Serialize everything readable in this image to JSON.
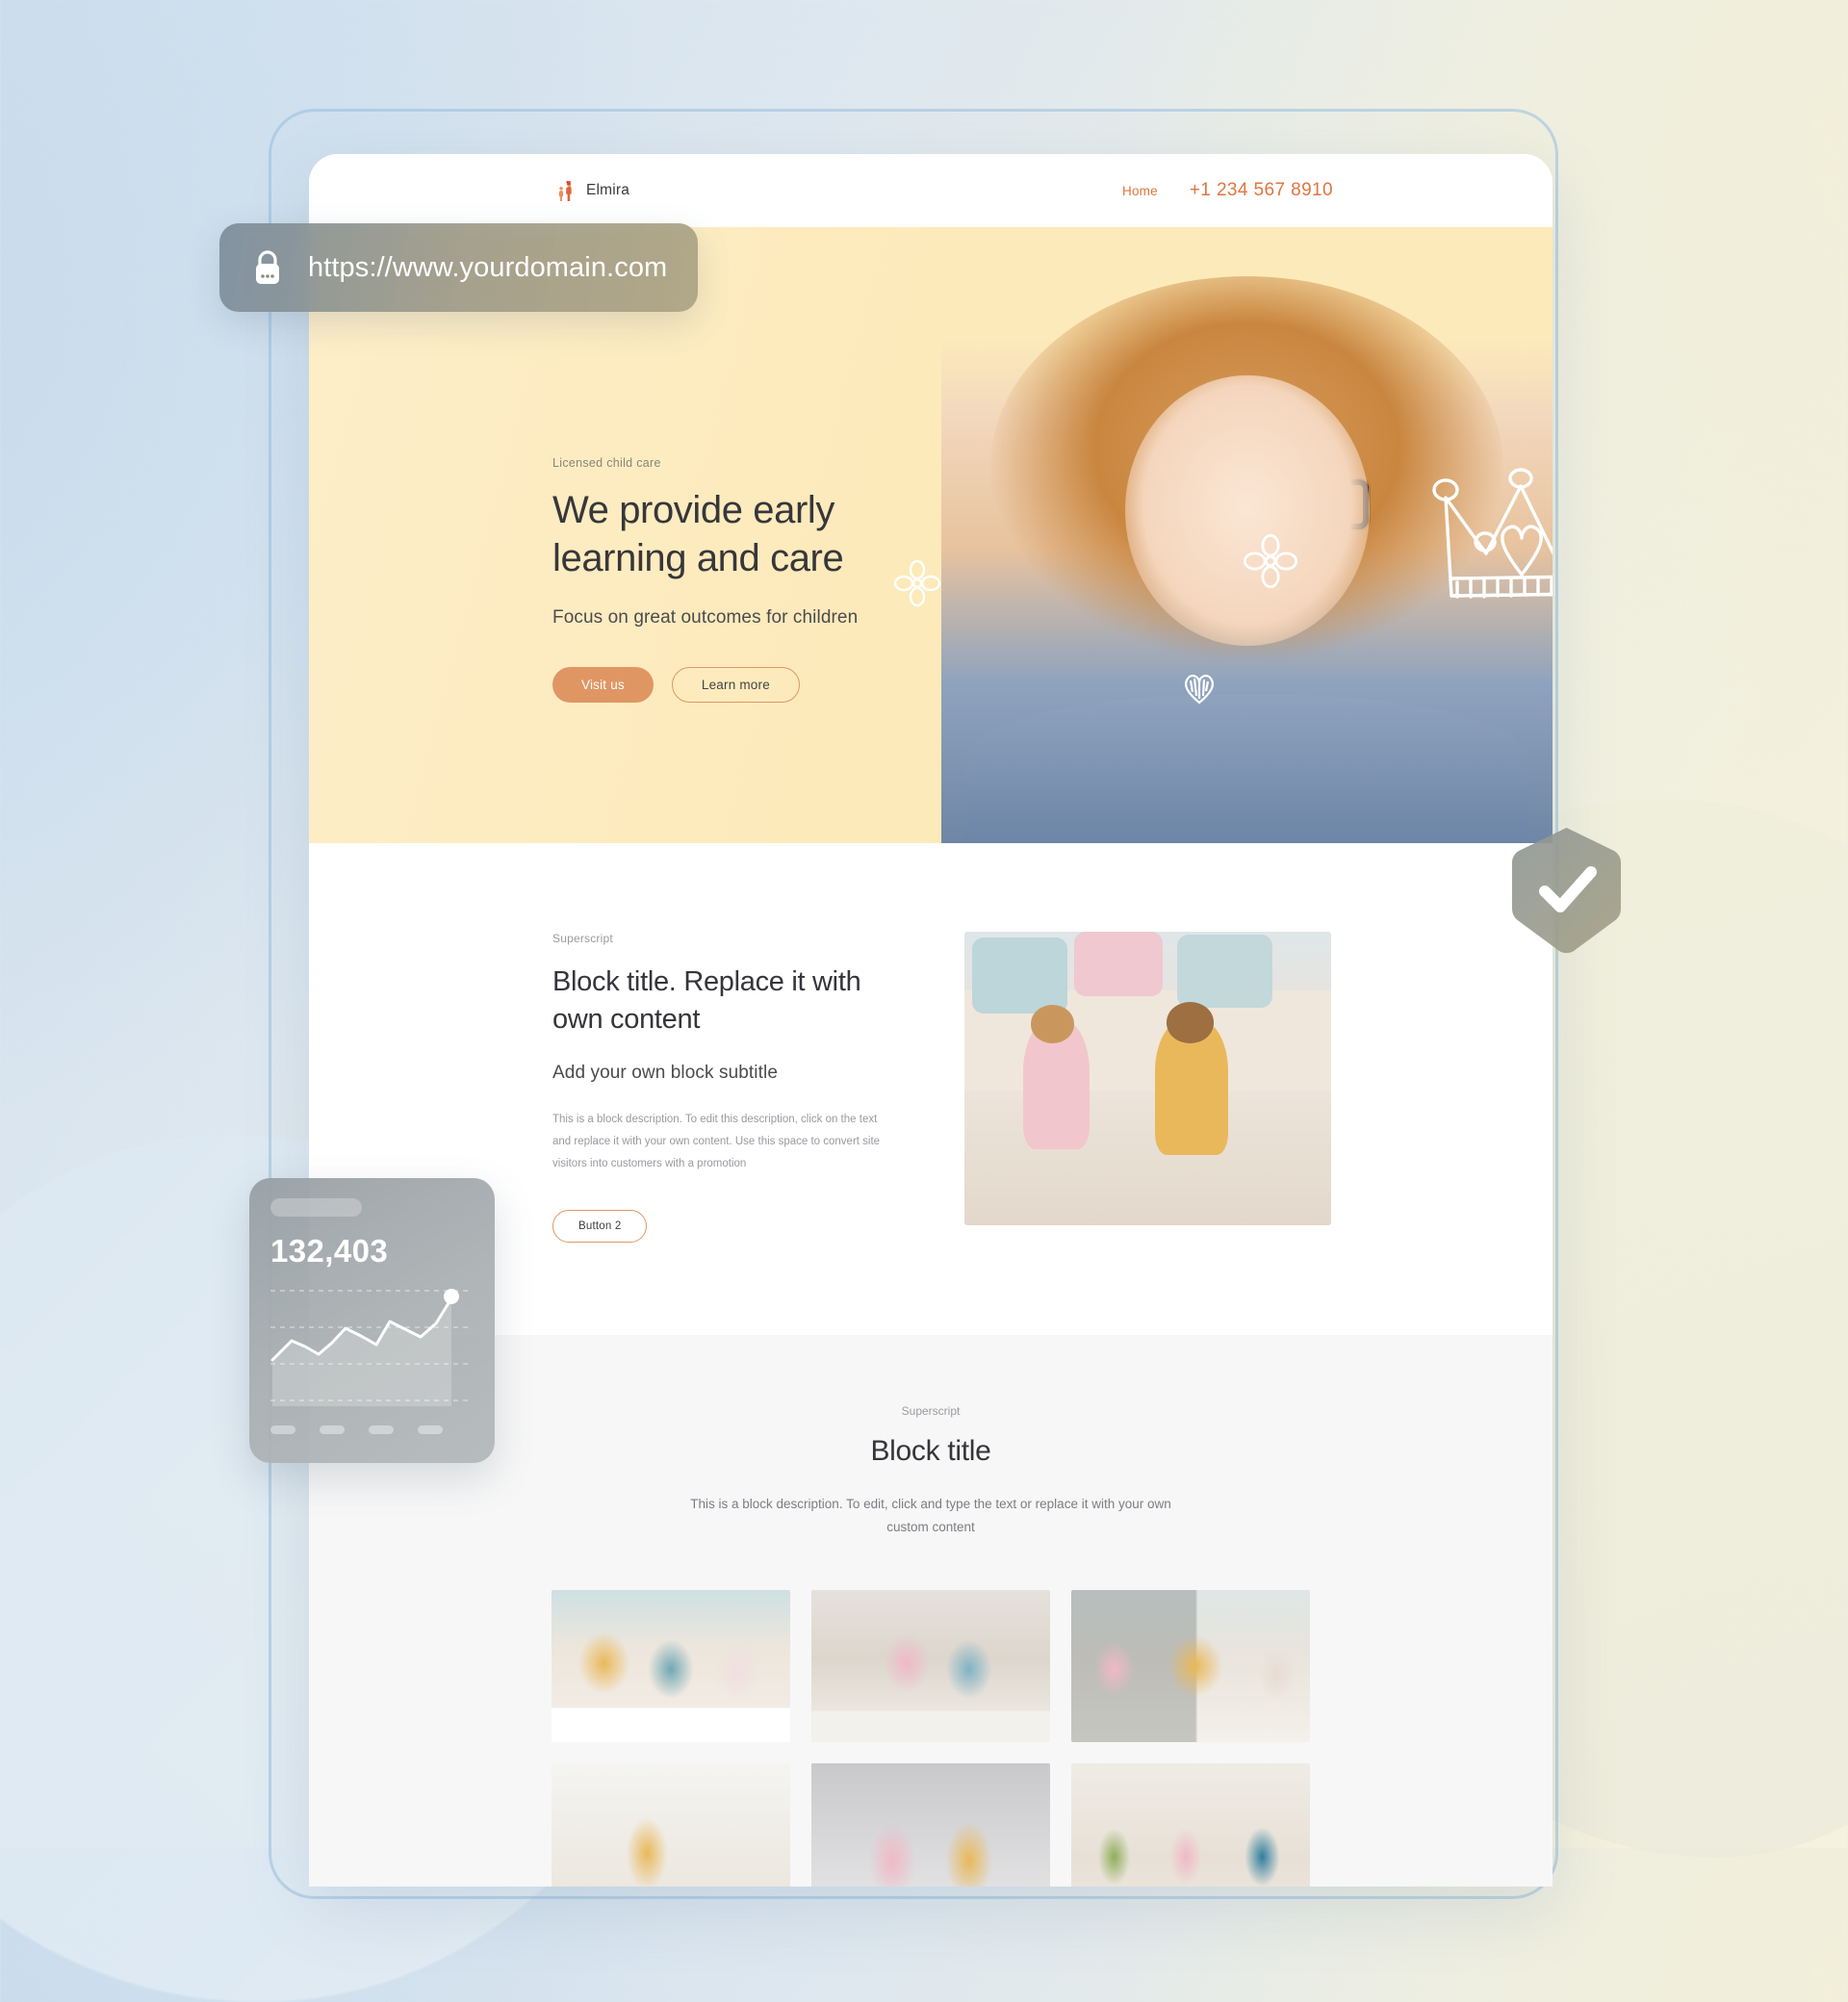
{
  "browser": {
    "url": "https://www.yourdomain.com",
    "lock_icon": "lock-icon"
  },
  "site": {
    "header": {
      "brand_name": "Elmira",
      "brand_logo_icon": "family-heart-logo-icon",
      "nav_links": [
        {
          "label": "Home"
        }
      ],
      "phone": "+1 234 567 8910"
    },
    "hero": {
      "eyebrow": "Licensed child care",
      "title_line1": "We provide early",
      "title_line2": "learning and care",
      "subtitle": "Focus on great outcomes for children",
      "primary_button": "Visit us",
      "secondary_button": "Learn more",
      "decorations": [
        "crown-doodle-icon",
        "heart-doodle-icon",
        "flower-doodle-icon",
        "sparkle-doodle-icon"
      ]
    },
    "block2": {
      "superscript": "Superscript",
      "title": "Block title. Replace it with own content",
      "subtitle": "Add your own block subtitle",
      "description": "This is a block description. To edit this description, click on the text and replace it with your own content. Use this space to convert site visitors into customers with a promotion",
      "button": "Button 2",
      "image_alt": "two-children-playing-on-rug"
    },
    "block3": {
      "superscript": "Superscript",
      "title": "Block title",
      "description": "This is a block description. To edit, click and type the text or replace it with your own custom content",
      "gallery": [
        {
          "alt": "three-children-stacking-blocks"
        },
        {
          "alt": "two-girls-painting"
        },
        {
          "alt": "children-drawing-at-table"
        },
        {
          "alt": "boy-with-wooden-plane"
        },
        {
          "alt": "girl-and-boy-holding-books"
        },
        {
          "alt": "three-children-reading-on-sofa"
        }
      ]
    }
  },
  "overlays": {
    "stats_card": {
      "value": "132,403",
      "chart_icon": "line-chart-icon"
    },
    "trust_badge": {
      "icon": "shield-check-icon",
      "label": "verified"
    }
  },
  "colors": {
    "accent": "#e0753f",
    "button_primary": "#e09663",
    "hero_background": "#fdeaba",
    "page_background_left": "#cfdfee",
    "page_background_right": "#f5f2de"
  }
}
